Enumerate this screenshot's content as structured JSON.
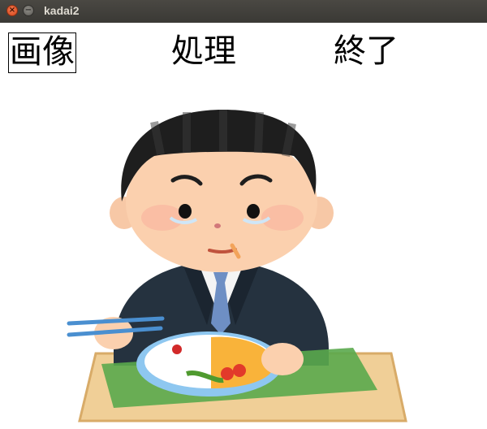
{
  "window": {
    "title": "kadai2",
    "close_glyph": "×",
    "minimize_glyph": "−"
  },
  "menu": [
    {
      "label": "画像",
      "selected": true
    },
    {
      "label": "処理",
      "selected": false
    },
    {
      "label": "終了",
      "selected": false
    }
  ],
  "image": {
    "subject": "man-eating-bento-illustration"
  }
}
